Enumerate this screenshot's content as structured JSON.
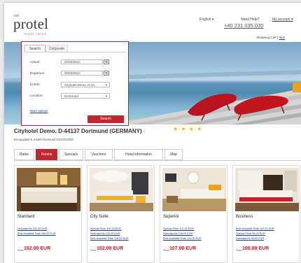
{
  "header": {
    "logo_the": "THE",
    "logo_main": "protel",
    "logo_sub": "HOTEL GROUP",
    "language": "English ▾",
    "need_help": "Need Help?",
    "phone": "+40 231 035 030",
    "account": "My account ▾",
    "cart_label": "Shopping Cart",
    "cart_item": "Item"
  },
  "search": {
    "tab_search": "Search",
    "tab_corporate": "Corporate",
    "arrival_label": "Arrival:",
    "arrival_value": "01/02/2012",
    "departure_label": "Departure:",
    "departure_value": "02/02/2012",
    "hotels_label": "Hotels:",
    "hotels_value": "Cityhotel Demo, D-44…",
    "location_label": "Location:",
    "location_value": "Dortmund",
    "more_options": "More options",
    "search_button": "Search"
  },
  "hotel": {
    "title": "Cityhotel Demo, D-44137 Dortmund (GERMANY)",
    "stars": "★ ★ ★ ★",
    "star_rating": 4,
    "address": "Europaplatz 8, 44269 Dortmund 0231/510300"
  },
  "tabs": [
    "Rates",
    "Rooms",
    "Specials",
    "Vouchers",
    "Hotel information",
    "Map"
  ],
  "active_tab": "Rooms",
  "rooms": [
    {
      "name": "Standard",
      "rates": [
        "Normalpreis 162,00 EUR",
        "Best Available Rate 180,00 EUR"
      ],
      "price_label": "Price",
      "price": "162.00 EUR"
    },
    {
      "name": "City Suite",
      "rates": [
        "Special Price 102,00 EUR",
        "Normalpreis 135,00 EUR",
        "Best Available Rate 125,00 EUR"
      ],
      "price_label": "Price",
      "price": "102.00 EUR"
    },
    {
      "name": "Superior",
      "rates": [
        "Special Price 107,00 EUR",
        "Normalpreis 138,00 EUR",
        "Best Available Rate 120,00 EUR"
      ],
      "price_label": "Price",
      "price": "107.00 EUR"
    },
    {
      "name": "Business",
      "rates": [
        "Best Available Rate 100,00 EUR",
        "Special Price 85,00 EUR",
        "Normalpreis 95,00 EUR"
      ],
      "price_label": "Price",
      "price": "100.00 EUR"
    }
  ],
  "colors": {
    "accent": "#c0262e",
    "star": "#f2b400",
    "link": "#1a3e8a"
  }
}
